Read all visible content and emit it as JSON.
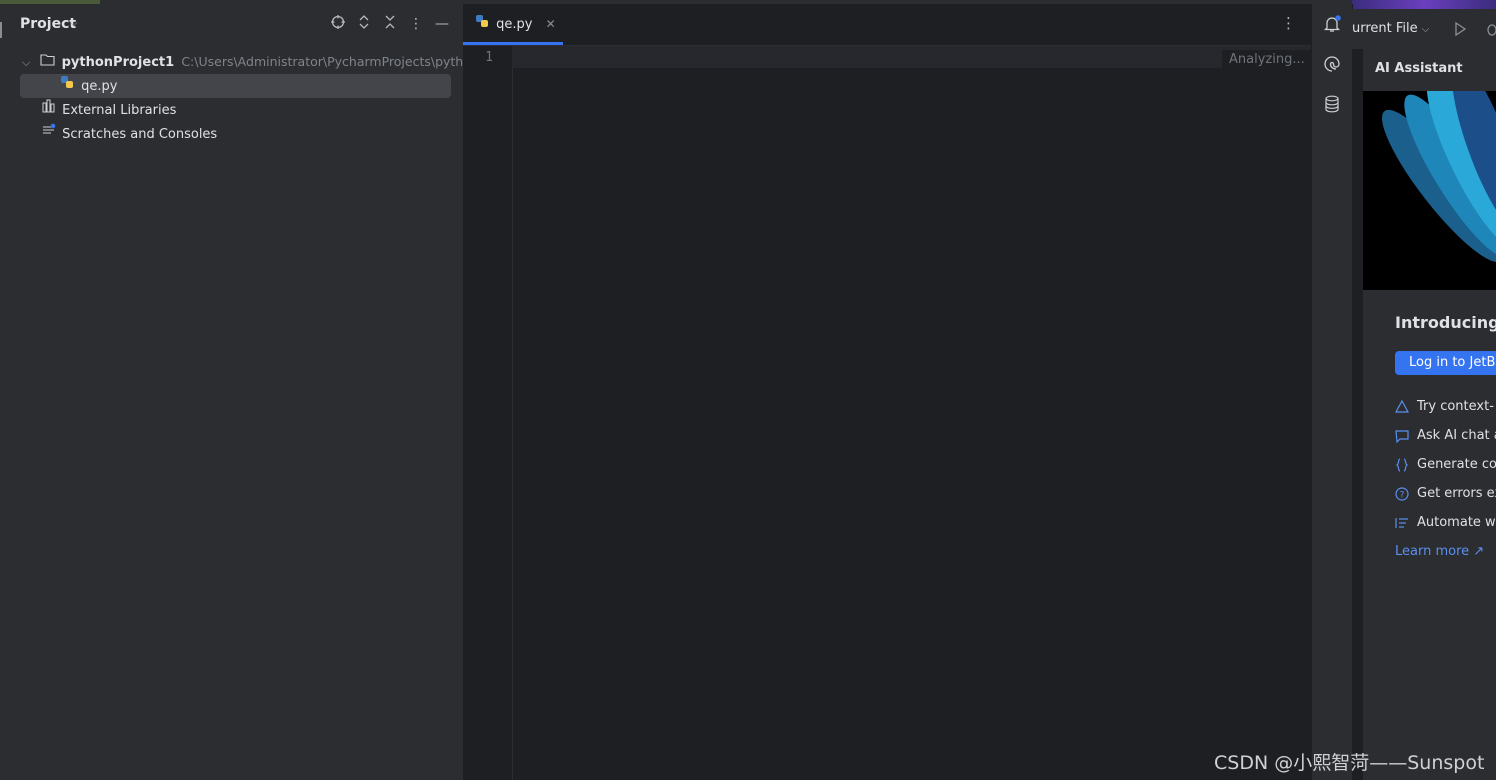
{
  "project_panel": {
    "title": "Project",
    "tree": {
      "root_name": "pythonProject1",
      "root_path": "C:\\Users\\Administrator\\PycharmProjects\\python",
      "file": "qe.py",
      "external_libraries": "External Libraries",
      "scratches": "Scratches and Consoles"
    }
  },
  "editor": {
    "tab_label": "qe.py",
    "line_number": "1",
    "status": "Analyzing..."
  },
  "run_config": {
    "label": "urrent File"
  },
  "ai_assistant": {
    "title": "AI Assistant",
    "heading": "Introducing",
    "login_button": "Log in to JetB",
    "features": [
      "Try context-",
      "Ask AI chat a",
      "Generate co",
      "Get errors ex",
      "Automate wr"
    ],
    "learn_more": "Learn more ↗"
  },
  "watermark": "CSDN @小熙智菏——Sunspot",
  "colors": {
    "accent": "#3574f0",
    "bg": "#1e1f22",
    "panel": "#2b2d30",
    "selection": "#43454a"
  }
}
